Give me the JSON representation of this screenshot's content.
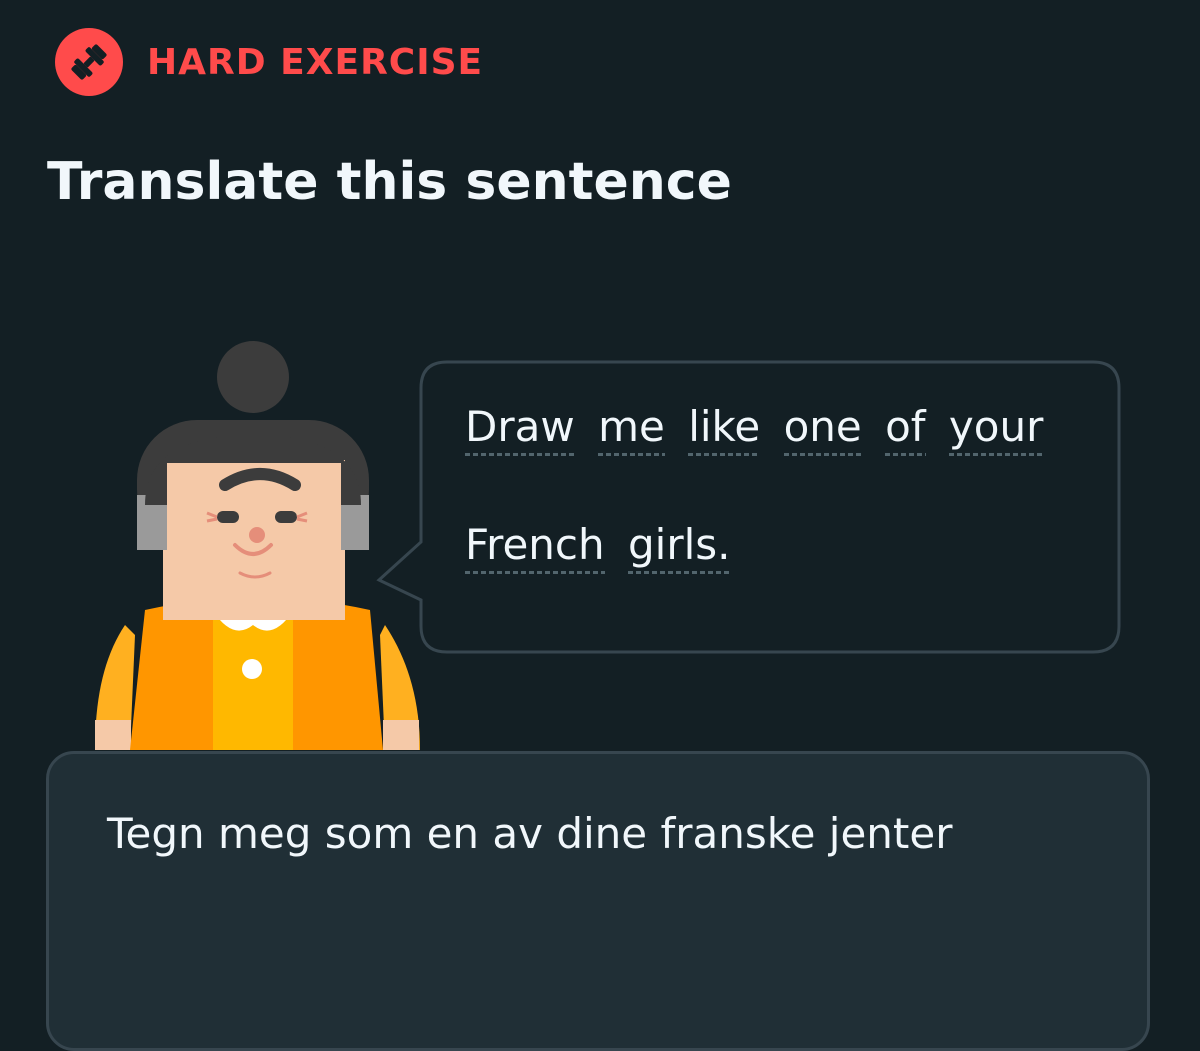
{
  "header": {
    "badge_icon": "dumbbell-icon",
    "badge_label": "HARD EXERCISE",
    "title": "Translate this sentence"
  },
  "prompt": {
    "character": "elderly-woman-character",
    "lines": [
      [
        "Draw",
        "me",
        "like",
        "one",
        "of",
        "your"
      ],
      [
        "French",
        "girls."
      ]
    ]
  },
  "answer": {
    "value": "Tegn meg som en av dine franske jenter"
  },
  "colors": {
    "background": "#131f24",
    "accent_red": "#ff4b4b",
    "text": "#f1f7fb",
    "bubble_border": "#37464f",
    "answer_bg": "#202f36"
  }
}
